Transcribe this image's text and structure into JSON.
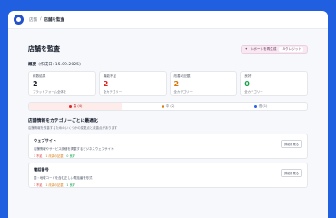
{
  "breadcrumb": {
    "root": "店舗",
    "sep": "/",
    "current": "店舗を監査"
  },
  "header": {
    "title": "店舗を監査",
    "report_label": "レポートを再生成",
    "credit_badge": "15クレジット"
  },
  "summary": {
    "label": "概要",
    "created": "(作成日: 15.09.2025)"
  },
  "cards": [
    {
      "label": "総数結果",
      "value": "2",
      "sub": "プラットフォーム全体を",
      "color": "#111827"
    },
    {
      "label": "機能不足",
      "value": "2",
      "sub": "全カテゴリー",
      "color": "#dc2626"
    },
    {
      "label": "改善の記載",
      "value": "2",
      "sub": "全カテゴリー",
      "color": "#d97706"
    },
    {
      "label": "良好",
      "value": "0",
      "sub": "全カテゴリー",
      "color": "#16a34a"
    }
  ],
  "tabs": [
    {
      "label": "高 (4)",
      "color": "#dc2626"
    },
    {
      "label": "中 (2)",
      "color": "#d97706"
    },
    {
      "label": "低 (1)",
      "color": "#2563eb"
    }
  ],
  "section": {
    "title": "店舗情報をカテゴリーごとに最適化",
    "subtitle": "店舗情報を改善するためのいくつかの変更点と改善点があります"
  },
  "items": [
    {
      "name": "ウェブサイト",
      "desc": "店舗情報やサービス詳細を掲載するビジネスウェブサイト",
      "tags": [
        "1 不足",
        "1 改善の記載",
        "0 良好"
      ],
      "button": "詳細を見る"
    },
    {
      "name": "電話番号",
      "desc": "国・地域コードを含む正しい電話番号形式",
      "tags": [
        "1 不足",
        "1 改善の記載",
        "1 良好"
      ],
      "button": "詳細を見る"
    }
  ]
}
